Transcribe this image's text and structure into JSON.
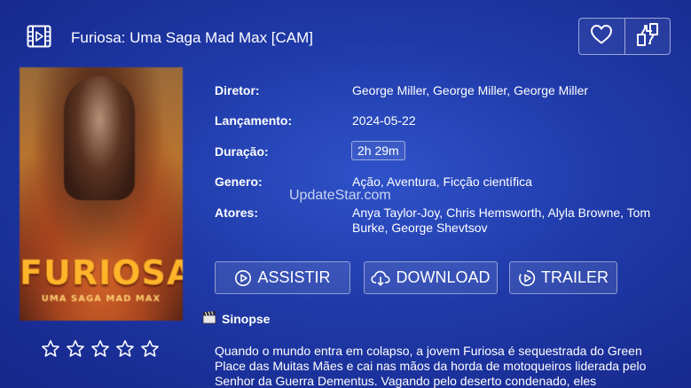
{
  "header": {
    "title": "Furiosa: Uma Saga Mad Max [CAM]",
    "icon": "film-icon"
  },
  "top_actions": {
    "favorite_icon": "heart-icon",
    "share_icon": "share-icon"
  },
  "poster": {
    "title": "FURIOSA",
    "subtitle": "UMA SAGA MAD MAX"
  },
  "rating": {
    "stars_total": 5,
    "stars_filled": 0
  },
  "info": {
    "director_label": "Diretor:",
    "director_value": "George Miller, George Miller, George Miller",
    "release_label": "Lançamento:",
    "release_value": "2024-05-22",
    "duration_label": "Duração:",
    "duration_value": "2h 29m",
    "genre_label": "Genero:",
    "genre_value": "Ação, Aventura, Ficção científica",
    "actors_label": "Atores:",
    "actors_value": "Anya Taylor-Joy, Chris Hemsworth, Alyla Browne, Tom Burke, George Shevtsov"
  },
  "watermark": "UpdateStar.com",
  "buttons": {
    "watch": "ASSISTIR",
    "download": "DOWNLOAD",
    "trailer": "TRAILER"
  },
  "synopsis": {
    "heading": "Sinopse",
    "text": "Quando o mundo entra em colapso, a jovem Furiosa é sequestrada do Green Place das Muitas Mães e cai nas mãos da horda de motoqueiros liderada pelo Senhor da Guerra Dementus. Vagando pelo deserto condenado, eles"
  },
  "colors": {
    "background_center": "#2f52c9",
    "background_edge": "#16268a",
    "text": "#ffffff"
  }
}
